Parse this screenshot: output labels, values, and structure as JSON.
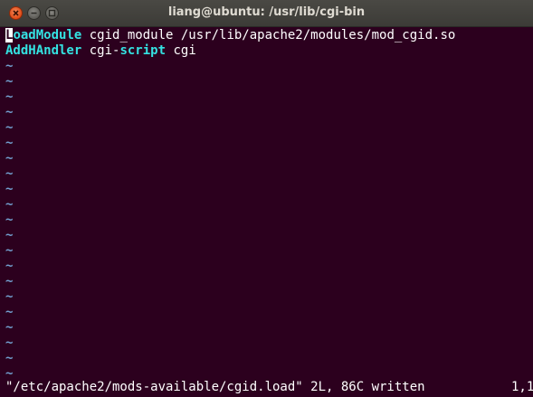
{
  "window": {
    "title": "liang@ubuntu: /usr/lib/cgi-bin"
  },
  "editor": {
    "lines": [
      {
        "cursor_char": "L",
        "keyword_rest": "oadModule",
        "text": " cgid_module /usr/lib/apache2/modules/mod_cgid.so"
      },
      {
        "keyword": "AddHAndler",
        "text_before": " cgi-",
        "keyword2": "script",
        "text_after": " cgi"
      }
    ],
    "empty_line_marker": "~",
    "status_message": "\"/etc/apache2/mods-available/cgid.load\" 2L, 86C written",
    "cursor_position": "1,1"
  },
  "colors": {
    "background": "#2c001e",
    "keyword": "#34e2e2",
    "tilde": "#729fcf",
    "text": "#ffffff"
  }
}
